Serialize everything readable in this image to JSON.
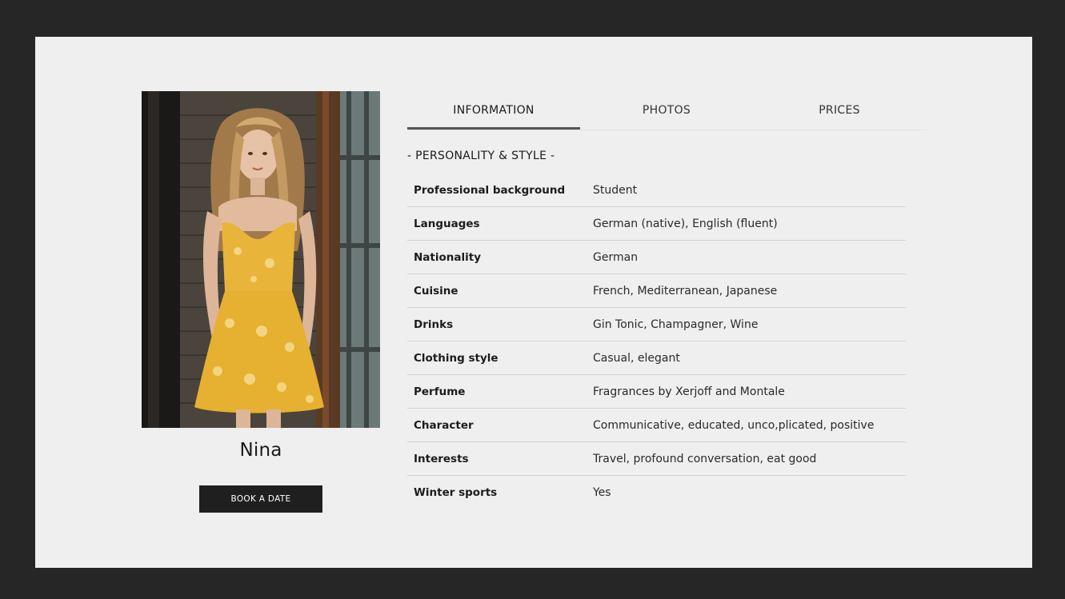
{
  "profile": {
    "name": "Nina",
    "book_label": "BOOK A DATE"
  },
  "tabs": [
    {
      "label": "INFORMATION",
      "active": true
    },
    {
      "label": "PHOTOS",
      "active": false
    },
    {
      "label": "PRICES",
      "active": false
    }
  ],
  "section": {
    "title": "- PERSONALITY & STYLE -"
  },
  "rows": [
    {
      "label": "Professional background",
      "value": "Student"
    },
    {
      "label": "Languages",
      "value": "German (native), English (fluent)"
    },
    {
      "label": "Nationality",
      "value": "German"
    },
    {
      "label": "Cuisine",
      "value": "French, Mediterranean, Japanese"
    },
    {
      "label": "Drinks",
      "value": "Gin Tonic, Champagner, Wine"
    },
    {
      "label": "Clothing style",
      "value": "Casual, elegant"
    },
    {
      "label": "Perfume",
      "value": "Fragrances by Xerjoff and Montale"
    },
    {
      "label": "Character",
      "value": "Communicative, educated, unco,plicated, positive"
    },
    {
      "label": "Interests",
      "value": "Travel, profound conversation, eat good"
    },
    {
      "label": "Winter sports",
      "value": "Yes"
    }
  ],
  "colors": {
    "frame": "#262626",
    "page": "#efeff0",
    "button": "#1f1f1f",
    "tab_underline": "#555555",
    "dress": "#e8b43a"
  },
  "icons": {
    "photo": "profile-photo"
  }
}
